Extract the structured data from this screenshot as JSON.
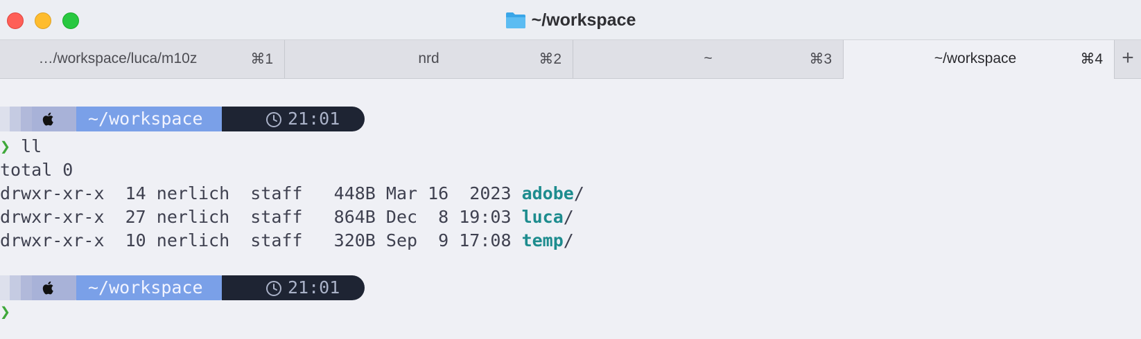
{
  "window": {
    "title": "~/workspace",
    "title_icon": "folder-icon"
  },
  "tabs": [
    {
      "label": "…/workspace/luca/m10z",
      "shortcut": "⌘1",
      "active": false
    },
    {
      "label": "nrd",
      "shortcut": "⌘2",
      "active": false
    },
    {
      "label": "~",
      "shortcut": "⌘3",
      "active": false
    },
    {
      "label": "~/workspace",
      "shortcut": "⌘4",
      "active": true
    }
  ],
  "add_tab_label": "+",
  "prompts": [
    {
      "path": "~/workspace",
      "time": "21:01",
      "os_icon": "apple-icon",
      "clock_icon": "clock-icon"
    },
    {
      "path": "~/workspace",
      "time": "21:01",
      "os_icon": "apple-icon",
      "clock_icon": "clock-icon"
    }
  ],
  "prompt_symbol": "❯",
  "command": "ll",
  "output": {
    "total": "total 0",
    "entries": [
      {
        "meta": "drwxr-xr-x  14 nerlich  staff   448B Mar 16  2023 ",
        "name": "adobe",
        "suffix": "/"
      },
      {
        "meta": "drwxr-xr-x  27 nerlich  staff   864B Dec  8 19:03 ",
        "name": "luca",
        "suffix": "/"
      },
      {
        "meta": "drwxr-xr-x  10 nerlich  staff   320B Sep  9 17:08 ",
        "name": "temp",
        "suffix": "/"
      }
    ]
  },
  "colors": {
    "directory": "#1d8c8e",
    "prompt_symbol": "#3fa83a",
    "path_segment": "#7aa0e8",
    "time_segment": "#1e2433"
  }
}
